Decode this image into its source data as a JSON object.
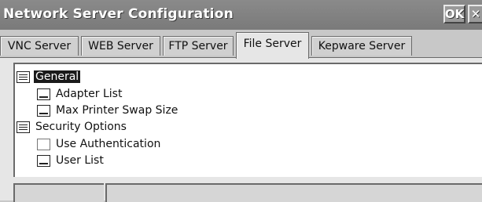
{
  "window": {
    "title": "Network Server Configuration",
    "ok_label": "OK",
    "close_label": "✕"
  },
  "tabs": [
    {
      "label": "VNC Server",
      "active": false
    },
    {
      "label": "WEB Server",
      "active": false
    },
    {
      "label": "FTP Server",
      "active": false
    },
    {
      "label": "File Server",
      "active": true
    },
    {
      "label": "Kepware Server",
      "active": false
    }
  ],
  "tree": [
    {
      "label": "General",
      "icon": "folder-list-icon",
      "selected": true
    },
    {
      "label": "Adapter List",
      "icon": "item-icon"
    },
    {
      "label": "Max Printer Swap Size",
      "icon": "item-icon"
    },
    {
      "label": "Security Options",
      "icon": "folder-list-icon"
    },
    {
      "label": "Use Authentication",
      "icon": "blank-item-icon"
    },
    {
      "label": "User List",
      "icon": "item-icon"
    }
  ],
  "status": [
    "",
    ""
  ],
  "colors": {
    "titlebar": "#7f7f7f",
    "selection": "#1a1a1a",
    "panel": "#e6e6e6"
  }
}
